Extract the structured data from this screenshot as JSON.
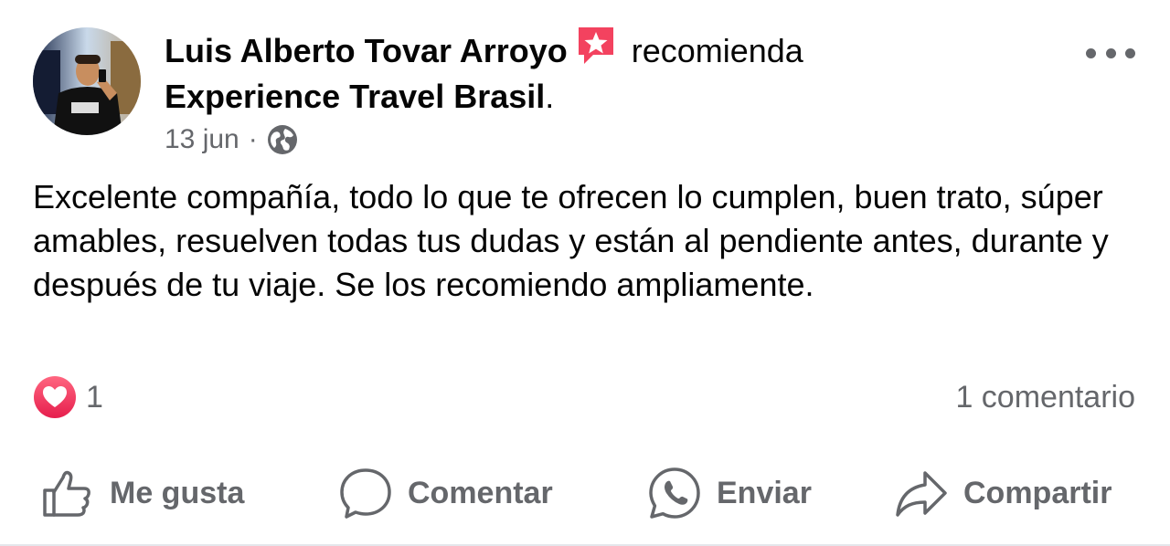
{
  "post": {
    "author": "Luis Alberto Tovar Arroyo",
    "recommends_verb": "recomienda",
    "page_name": "Experience Travel Brasil",
    "page_suffix": ".",
    "date": "13 jun",
    "separator": "·",
    "privacy_icon": "globe-icon",
    "body": "Excelente compañía, todo lo que te ofrecen lo cumplen, buen trato, súper amables, resuelven todas tus dudas y están al pendiente antes, durante y después de tu viaje. Se los recomiendo ampliamente.",
    "reaction_count": "1",
    "reaction_icon": "heart-icon",
    "comment_count": "1 comentario"
  },
  "actions": {
    "like": "Me gusta",
    "comment": "Comentar",
    "send": "Enviar",
    "share": "Compartir"
  },
  "colors": {
    "text_primary": "#050505",
    "text_secondary": "#65676b",
    "recommend_badge": "#f3425f",
    "heart_gradient_top": "#ff6680",
    "heart_gradient_bottom": "#e61e4d",
    "divider": "#e4e6eb"
  }
}
